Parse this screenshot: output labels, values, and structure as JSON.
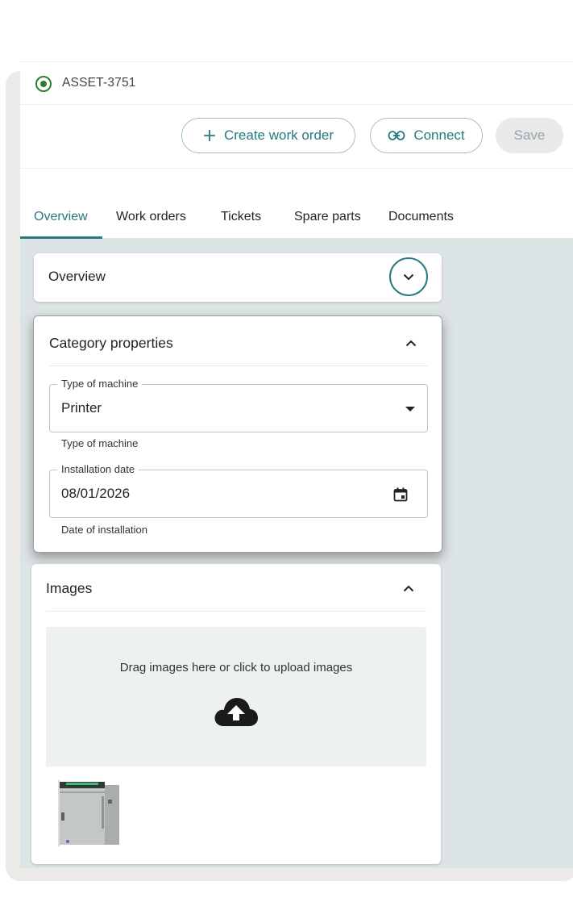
{
  "asset": {
    "id": "ASSET-3751"
  },
  "actions": {
    "create_work_order": "Create work order",
    "connect": "Connect",
    "save": "Save"
  },
  "tabs": [
    {
      "label": "Overview",
      "active": true
    },
    {
      "label": "Work orders"
    },
    {
      "label": "Tickets"
    },
    {
      "label": "Spare parts"
    },
    {
      "label": "Documents"
    }
  ],
  "overview_card": {
    "title": "Overview",
    "toggle_icon": "chevron-down-icon"
  },
  "category_card": {
    "title": "Category properties",
    "collapse_icon": "chevron-up-icon",
    "type_of_machine": {
      "legend": "Type of machine",
      "value": "Printer",
      "helper": "Type of machine"
    },
    "installation_date": {
      "legend": "Installation date",
      "value": "08/01/2026",
      "helper": "Date of installation",
      "icon": "calendar-icon"
    }
  },
  "images_card": {
    "title": "Images",
    "collapse_icon": "chevron-up-icon",
    "dropzone_text": "Drag images here or click to upload images",
    "upload_icon": "cloud-upload-icon"
  },
  "colors": {
    "accent": "#267a80",
    "content_bg": "#dde4e5",
    "status_icon": "#2e7d32"
  }
}
